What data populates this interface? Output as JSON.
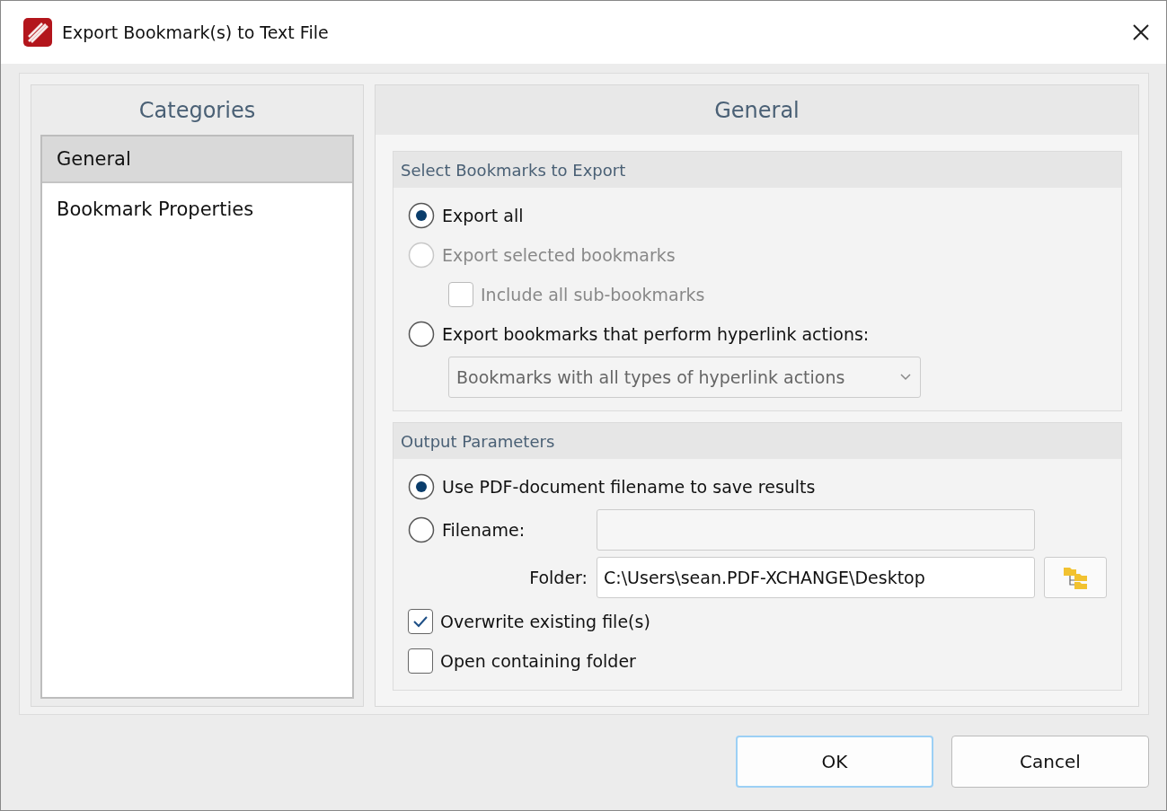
{
  "window": {
    "title": "Export Bookmark(s) to Text File"
  },
  "categories": {
    "title": "Categories",
    "items": [
      {
        "label": "General",
        "selected": true
      },
      {
        "label": "Bookmark Properties",
        "selected": false
      }
    ]
  },
  "panel": {
    "title": "General"
  },
  "select_group": {
    "title": "Select Bookmarks to Export",
    "options": [
      {
        "kind": "radio",
        "label": "Export all",
        "selected": true,
        "disabled": false
      },
      {
        "kind": "radio",
        "label": "Export selected bookmarks",
        "selected": false,
        "disabled": true,
        "children": [
          {
            "kind": "checkbox",
            "label": "Include all sub-bookmarks",
            "checked": false,
            "disabled": true
          }
        ]
      },
      {
        "kind": "radio",
        "label": "Export bookmarks that perform hyperlink actions:",
        "selected": false,
        "disabled": false,
        "children": [
          {
            "kind": "dropdown",
            "value": "Bookmarks with all types of hyperlink actions",
            "disabled": true
          }
        ]
      }
    ]
  },
  "output_group": {
    "title": "Output Parameters",
    "use_pdf_name": {
      "label": "Use PDF-document filename to save results",
      "selected": true
    },
    "filename": {
      "label": "Filename:",
      "selected": false
    },
    "folder": {
      "label": "Folder:",
      "value": "C:\\Users\\sean.PDF-XCHANGE\\Desktop"
    },
    "checkboxes": [
      {
        "label": "Overwrite existing file(s)",
        "checked": true
      },
      {
        "label": "Open containing folder",
        "checked": false
      }
    ]
  },
  "buttons": [
    {
      "label": "OK",
      "default": true
    },
    {
      "label": "Cancel",
      "default": false
    }
  ]
}
